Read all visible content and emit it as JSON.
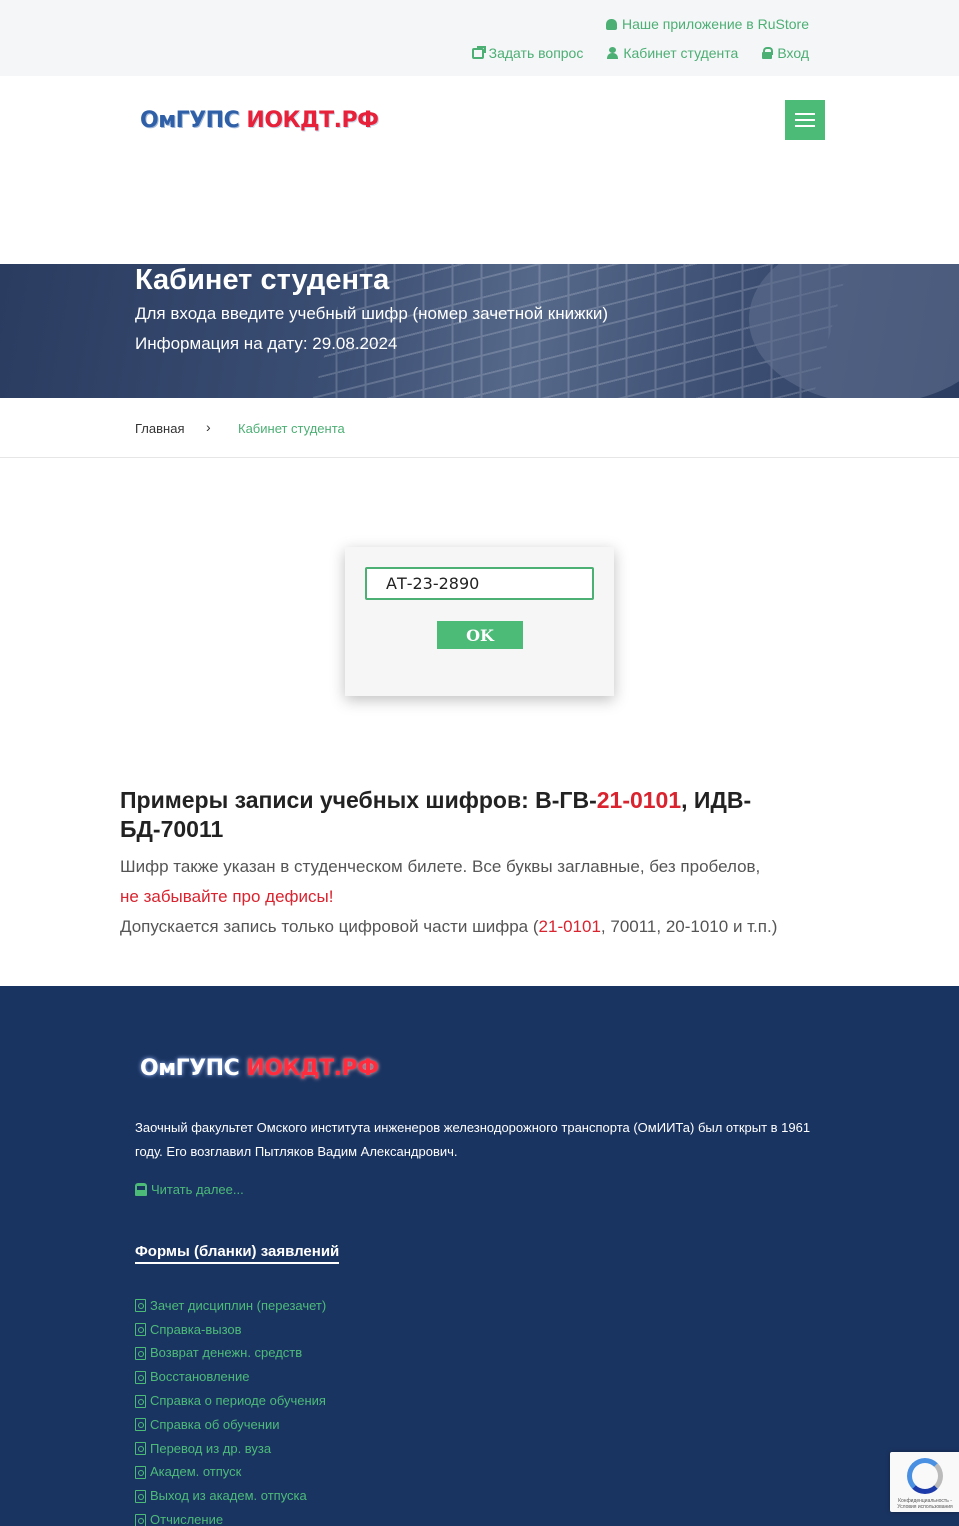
{
  "topbar": {
    "app_link": "Наше приложение в RuStore",
    "ask_link": "Задать вопрос",
    "cabinet_link": "Кабинет студента",
    "login_link": "Вход"
  },
  "header": {
    "logo_part1": "ОмГУПС",
    "logo_part2": "ИОКДТ.РФ",
    "menu_icon": "hamburger-icon"
  },
  "hero": {
    "title": "Кабинет студента",
    "subtitle": "Для входа введите учебный шифр (номер зачетной книжки)",
    "date_info": "Информация на дату: 29.08.2024"
  },
  "breadcrumb": {
    "home": "Главная",
    "separator": "›",
    "current": "Кабинет студента"
  },
  "login": {
    "cipher_value": "АТ-23-2890",
    "ok_label": "OK"
  },
  "examples": {
    "heading_prefix": "Примеры записи учебных шифров: В-ГВ-",
    "heading_red": "21-0101",
    "heading_suffix": ", ИДВ-БД-70011",
    "note_text": "Шифр также указан в студенческом билете. Все буквы заглавные, без пробелов, ",
    "note_red": "не забывайте про дефисы!",
    "digits_prefix": "Допускается запись только цифровой части шифра (",
    "digits_red": "21-0101",
    "digits_suffix": ", 70011, 20-1010 и т.п.)"
  },
  "footer": {
    "logo_part1": "ОмГУПС",
    "logo_part2": "ИОКДТ.РФ",
    "about": "Заочный факультет Омского института инженеров железнодорожного транспорта (ОмИИТа) был открыт в 1961 году. Его возглавил Пытляков Вадим Александрович.",
    "read_more": "Читать далее...",
    "forms_heading": "Формы (бланки) заявлений",
    "forms": [
      "Зачет дисциплин (перезачет)",
      "Справка-вызов",
      "Возврат денежн. средств",
      "Восстановление",
      "Справка о периоде обучения",
      "Справка об обучении",
      "Перевод из др. вуза",
      "Академ. отпуск",
      "Выход из академ. отпуска",
      "Отчисление"
    ]
  },
  "recaptcha": {
    "text": "Конфиденциальность - Условия использования"
  },
  "colors": {
    "accent": "#4cbb78",
    "footer_bg": "#1a3462",
    "red": "#d9232e"
  }
}
